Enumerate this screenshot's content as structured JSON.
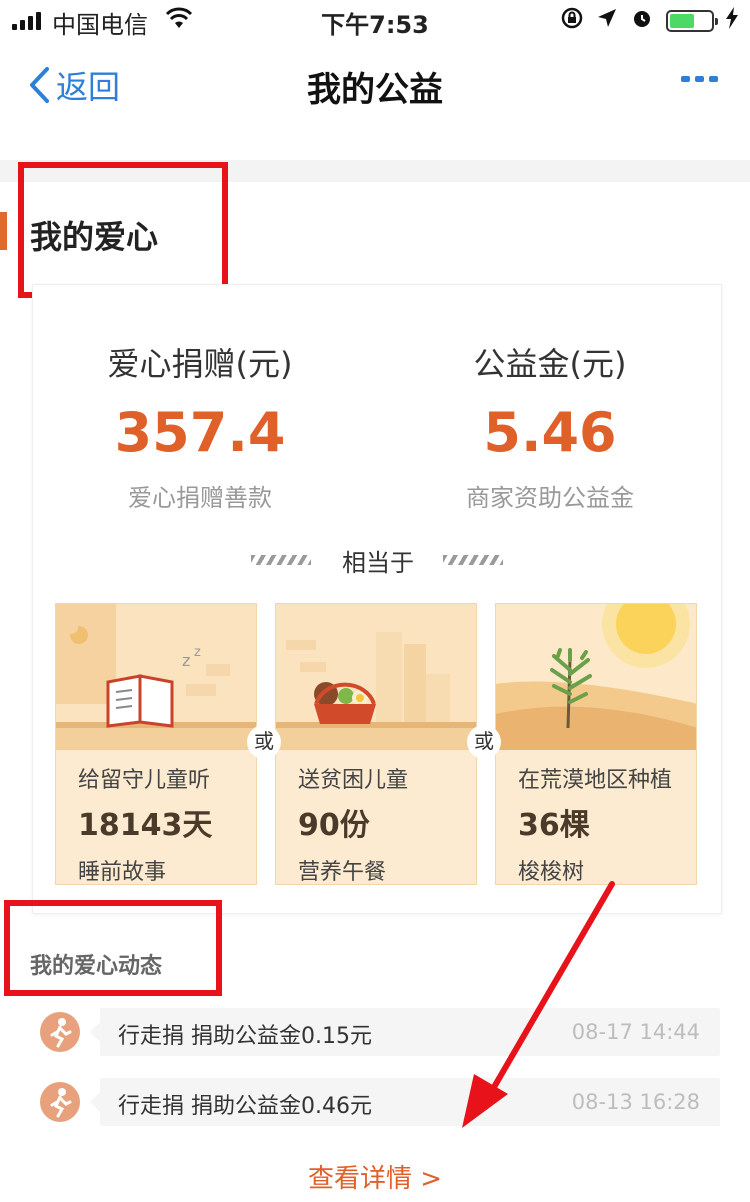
{
  "status_bar": {
    "carrier": "中国电信",
    "time": "下午7:53",
    "battery_level": 0.6
  },
  "nav": {
    "back_label": "返回",
    "title": "我的公益"
  },
  "section": {
    "title": "我的爱心"
  },
  "stats": {
    "donation": {
      "label": "爱心捐赠(元)",
      "value": "357.4",
      "sub": "爱心捐赠善款"
    },
    "fund": {
      "label": "公益金(元)",
      "value": "5.46",
      "sub": "商家资助公益金"
    }
  },
  "equivalent_label": "相当于",
  "or_label": "或",
  "tiles": [
    {
      "line1": "给留守儿童听",
      "line2": "18143天",
      "line3": "睡前故事",
      "icon": "storybook-icon"
    },
    {
      "line1": "送贫困儿童",
      "line2": "90份",
      "line3": "营养午餐",
      "icon": "lunch-basket-icon"
    },
    {
      "line1": "在荒漠地区种植",
      "line2": "36棵",
      "line3": "梭梭树",
      "icon": "saxaul-tree-icon"
    }
  ],
  "feed": {
    "title": "我的爱心动态",
    "items": [
      {
        "text": "行走捐  捐助公益金0.15元",
        "time": "08-17 14:44"
      },
      {
        "text": "行走捐  捐助公益金0.46元",
        "time": "08-13 16:28"
      }
    ]
  },
  "details_link": "查看详情 >",
  "colors": {
    "accent": "#e0602a",
    "link": "#2f7fd8",
    "annotation": "#e8121b"
  }
}
